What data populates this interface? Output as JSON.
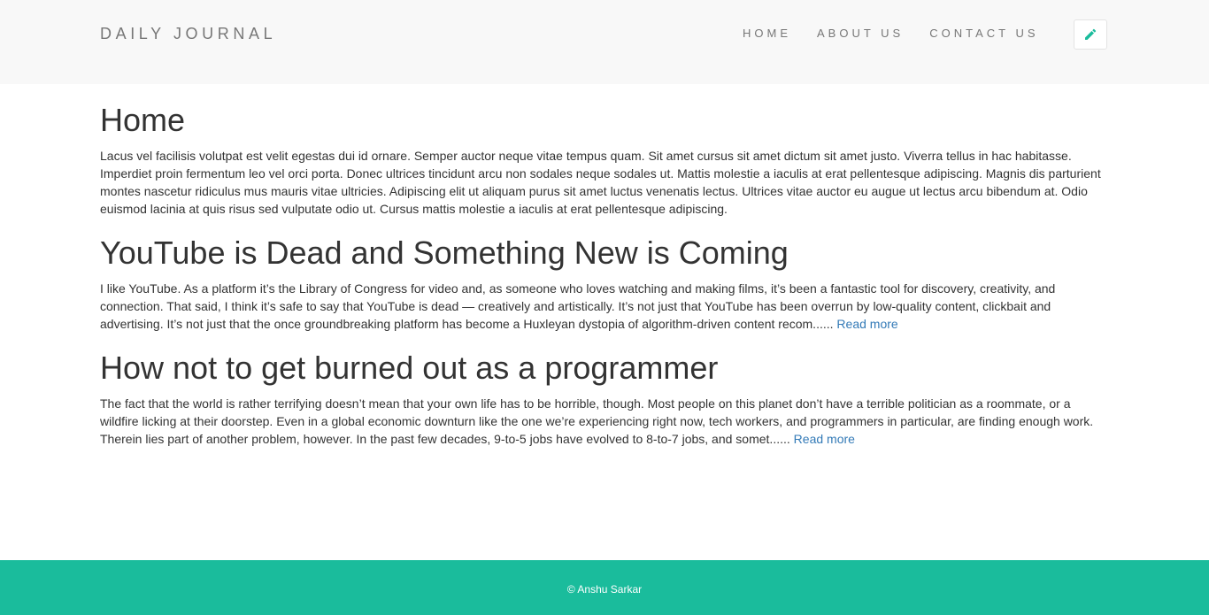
{
  "navbar": {
    "brand": "DAILY JOURNAL",
    "links": {
      "home": "HOME",
      "about": "ABOUT US",
      "contact": "CONTACT US"
    },
    "compose_icon": "pencil-icon",
    "accent_color": "#1abc9c"
  },
  "home": {
    "title": "Home",
    "body": "Lacus vel facilisis volutpat est velit egestas dui id ornare. Semper auctor neque vitae tempus quam. Sit amet cursus sit amet dictum sit amet justo. Viverra tellus in hac habitasse. Imperdiet proin fermentum leo vel orci porta. Donec ultrices tincidunt arcu non sodales neque sodales ut. Mattis molestie a iaculis at erat pellentesque adipiscing. Magnis dis parturient montes nascetur ridiculus mus mauris vitae ultricies. Adipiscing elit ut aliquam purus sit amet luctus venenatis lectus. Ultrices vitae auctor eu augue ut lectus arcu bibendum at. Odio euismod lacinia at quis risus sed vulputate odio ut. Cursus mattis molestie a iaculis at erat pellentesque adipiscing."
  },
  "posts": [
    {
      "title": "YouTube is Dead and Something New is Coming",
      "excerpt": "I like YouTube. As a platform it’s the Library of Congress for video and, as someone who loves watching and making films, it’s been a fantastic tool for discovery, creativity, and connection. That said, I think it’s safe to say that YouTube is dead — creatively and artistically. It’s not just that YouTube has been overrun by low-quality content, clickbait and advertising. It’s not just that the once groundbreaking platform has become a Huxleyan dystopia of algorithm-driven content recom......",
      "read_more": "Read more"
    },
    {
      "title": "How not to get burned out as a programmer",
      "excerpt": "The fact that the world is rather terrifying doesn’t mean that your own life has to be horrible, though. Most people on this planet don’t have a terrible politician as a roommate, or a wildfire licking at their doorstep. Even in a global economic downturn like the one we’re experiencing right now, tech workers, and programmers in particular, are finding enough work. Therein lies part of another problem, however. In the past few decades, 9-to-5 jobs have evolved to 8-to-7 jobs, and somet......",
      "read_more": "Read more"
    }
  ],
  "footer": {
    "text": "© Anshu Sarkar"
  }
}
